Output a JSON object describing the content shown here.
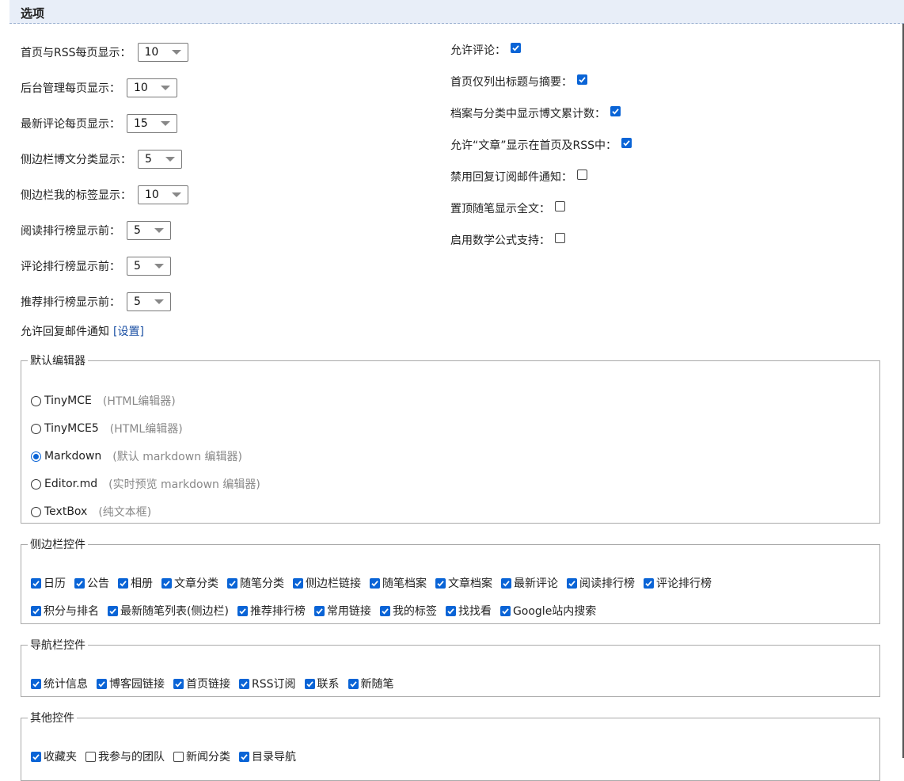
{
  "section": {
    "title": "选项"
  },
  "left_options": [
    {
      "label": "首页与RSS每页显示：",
      "value": "10"
    },
    {
      "label": "后台管理每页显示：",
      "value": "10"
    },
    {
      "label": "最新评论每页显示：",
      "value": "15"
    },
    {
      "label": "侧边栏博文分类显示：",
      "value": "5"
    },
    {
      "label": "侧边栏我的标签显示：",
      "value": "10"
    },
    {
      "label": "阅读排行榜显示前：",
      "value": "5"
    },
    {
      "label": "评论排行榜显示前：",
      "value": "5"
    },
    {
      "label": "推荐排行榜显示前：",
      "value": "5"
    }
  ],
  "reply_notify": {
    "label": "允许回复邮件通知",
    "link": "[设置]"
  },
  "right_options": [
    {
      "label": "允许评论：",
      "checked": true
    },
    {
      "label": "首页仅列出标题与摘要：",
      "checked": true
    },
    {
      "label": "档案与分类中显示博文累计数：",
      "checked": true
    },
    {
      "label": "允许“文章”显示在首页及RSS中：",
      "checked": true
    },
    {
      "label": "禁用回复订阅邮件通知：",
      "checked": false
    },
    {
      "label": "置顶随笔显示全文：",
      "checked": false
    },
    {
      "label": "启用数学公式支持：",
      "checked": false
    }
  ],
  "editor": {
    "legend": "默认编辑器",
    "options": [
      {
        "label": "TinyMCE",
        "hint": "(HTML编辑器)",
        "selected": false
      },
      {
        "label": "TinyMCE5",
        "hint": "(HTML编辑器)",
        "selected": false
      },
      {
        "label": "Markdown",
        "hint": "(默认 markdown 编辑器)",
        "selected": true
      },
      {
        "label": "Editor.md",
        "hint": "(实时预览 markdown 编辑器)",
        "selected": false
      },
      {
        "label": "TextBox",
        "hint": "(纯文本框)",
        "selected": false
      }
    ]
  },
  "sidebar_controls": {
    "legend": "侧边栏控件",
    "row1": [
      {
        "label": "日历",
        "checked": true
      },
      {
        "label": "公告",
        "checked": true
      },
      {
        "label": "相册",
        "checked": true
      },
      {
        "label": "文章分类",
        "checked": true
      },
      {
        "label": "随笔分类",
        "checked": true
      },
      {
        "label": "侧边栏链接",
        "checked": true
      },
      {
        "label": "随笔档案",
        "checked": true
      },
      {
        "label": "文章档案",
        "checked": true
      },
      {
        "label": "最新评论",
        "checked": true
      },
      {
        "label": "阅读排行榜",
        "checked": true
      },
      {
        "label": "评论排行榜",
        "checked": true
      }
    ],
    "row2": [
      {
        "label": "积分与排名",
        "checked": true
      },
      {
        "label": "最新随笔列表(侧边栏)",
        "checked": true
      },
      {
        "label": "推荐排行榜",
        "checked": true
      },
      {
        "label": "常用链接",
        "checked": true
      },
      {
        "label": "我的标签",
        "checked": true
      },
      {
        "label": "找找看",
        "checked": true
      },
      {
        "label": "Google站内搜索",
        "checked": true
      }
    ]
  },
  "nav_controls": {
    "legend": "导航栏控件",
    "items": [
      {
        "label": "统计信息",
        "checked": true
      },
      {
        "label": "博客园链接",
        "checked": true
      },
      {
        "label": "首页链接",
        "checked": true
      },
      {
        "label": "RSS订阅",
        "checked": true
      },
      {
        "label": "联系",
        "checked": true
      },
      {
        "label": "新随笔",
        "checked": true
      }
    ]
  },
  "other_controls": {
    "legend": "其他控件",
    "items": [
      {
        "label": "收藏夹",
        "checked": true
      },
      {
        "label": "我参与的团队",
        "checked": false
      },
      {
        "label": "新闻分类",
        "checked": false
      },
      {
        "label": "目录导航",
        "checked": true
      }
    ]
  }
}
